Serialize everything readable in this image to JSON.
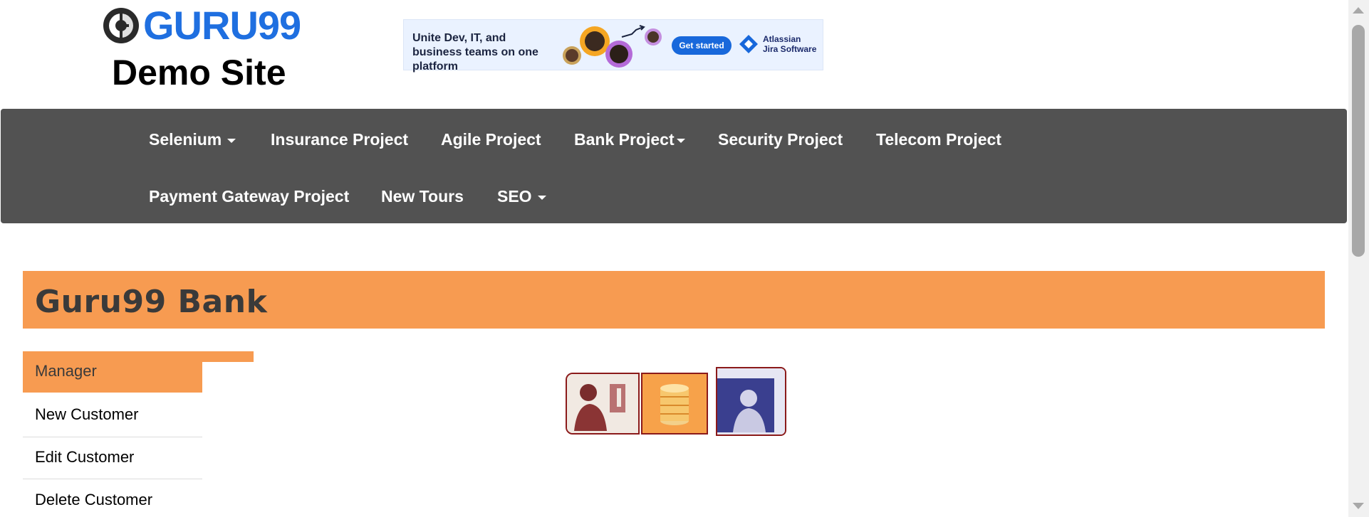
{
  "header": {
    "logo_text": "GURU99",
    "subtitle": "Demo Site"
  },
  "ad": {
    "headline": "Unite Dev, IT, and business teams on one platform",
    "button_label": "Get started",
    "brand_line1": "Atlassian",
    "brand_line2": "Jira Software"
  },
  "nav": {
    "row1": [
      {
        "label": "Selenium",
        "dropdown": true
      },
      {
        "label": "Insurance Project",
        "dropdown": false
      },
      {
        "label": "Agile Project",
        "dropdown": false
      },
      {
        "label": "Bank Project",
        "dropdown": true
      },
      {
        "label": "Security Project",
        "dropdown": false
      },
      {
        "label": "Telecom Project",
        "dropdown": false
      }
    ],
    "row2": [
      {
        "label": "Payment Gateway Project",
        "dropdown": false
      },
      {
        "label": "New Tours",
        "dropdown": false
      },
      {
        "label": "SEO",
        "dropdown": true
      }
    ]
  },
  "page": {
    "title": "Guru99 Bank"
  },
  "sidebar": {
    "items": [
      {
        "label": "Manager",
        "active": true
      },
      {
        "label": "New Customer",
        "active": false
      },
      {
        "label": "Edit Customer",
        "active": false
      },
      {
        "label": "Delete Customer",
        "active": false
      }
    ]
  },
  "colors": {
    "accent": "#f79b51",
    "nav_bg": "#525252",
    "logo_blue": "#1f6fe0"
  }
}
